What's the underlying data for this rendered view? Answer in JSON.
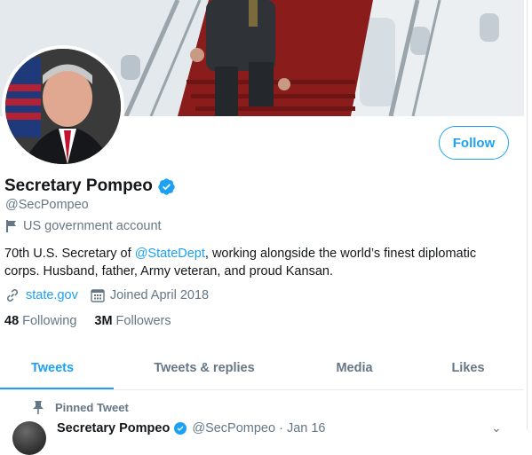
{
  "profile": {
    "display_name": "Secretary Pompeo",
    "handle": "@SecPompeo",
    "account_type": "US government account",
    "bio_prefix": "70th U.S. Secretary of ",
    "bio_mention": "@StateDept",
    "bio_suffix": ", working alongside the world’s finest diplomatic corps. Husband, father, Army veteran, and proud Kansan.",
    "website": "state.gov",
    "joined": "Joined April 2018",
    "following_count": "48",
    "following_label": "Following",
    "followers_count": "3M",
    "followers_label": "Followers"
  },
  "actions": {
    "follow_label": "Follow"
  },
  "tabs": [
    {
      "label": "Tweets",
      "active": true
    },
    {
      "label": "Tweets & replies",
      "active": false
    },
    {
      "label": "Media",
      "active": false
    },
    {
      "label": "Likes",
      "active": false
    }
  ],
  "pinned": {
    "label": "Pinned Tweet",
    "author_name": "Secretary Pompeo",
    "author_handle": "@SecPompeo · Jan 16"
  },
  "colors": {
    "accent": "#1da1f2",
    "muted_text": "#657786",
    "primary_text": "#14171a"
  },
  "icons": [
    "verified-badge-icon",
    "flag-icon",
    "link-icon",
    "calendar-icon",
    "pin-icon",
    "caret-down-icon"
  ]
}
